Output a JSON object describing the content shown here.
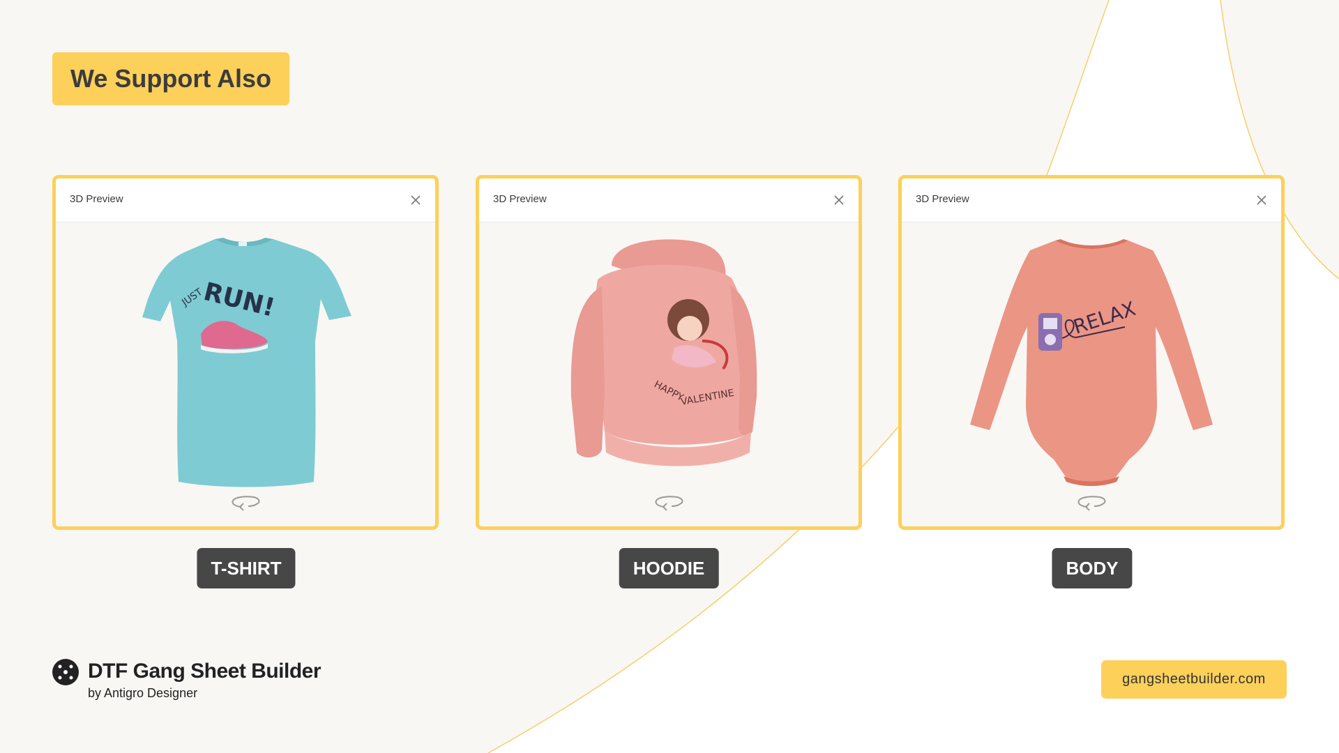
{
  "headline": "We Support Also",
  "colors": {
    "accent": "#fdd05a",
    "pill": "#474747",
    "background": "#f8f7f4"
  },
  "cards": [
    {
      "header": "3D Preview",
      "product": "T-SHIRT",
      "garment_color": "#7fcbd3",
      "print_text": [
        "JUST",
        "RUN!"
      ]
    },
    {
      "header": "3D Preview",
      "product": "HOODIE",
      "garment_color": "#efa8a1",
      "print_text": [
        "HAPPY",
        "VALENTINE"
      ]
    },
    {
      "header": "3D Preview",
      "product": "BODY",
      "garment_color": "#eb9585",
      "print_text": [
        "RELAX"
      ]
    }
  ],
  "icons": {
    "close": "close-icon",
    "rotate": "rotate-360-icon",
    "logo": "brand-logo-icon"
  },
  "brand": {
    "name": "DTF Gang Sheet Builder",
    "by": "by Antigro Designer"
  },
  "website": "gangsheetbuilder.com"
}
